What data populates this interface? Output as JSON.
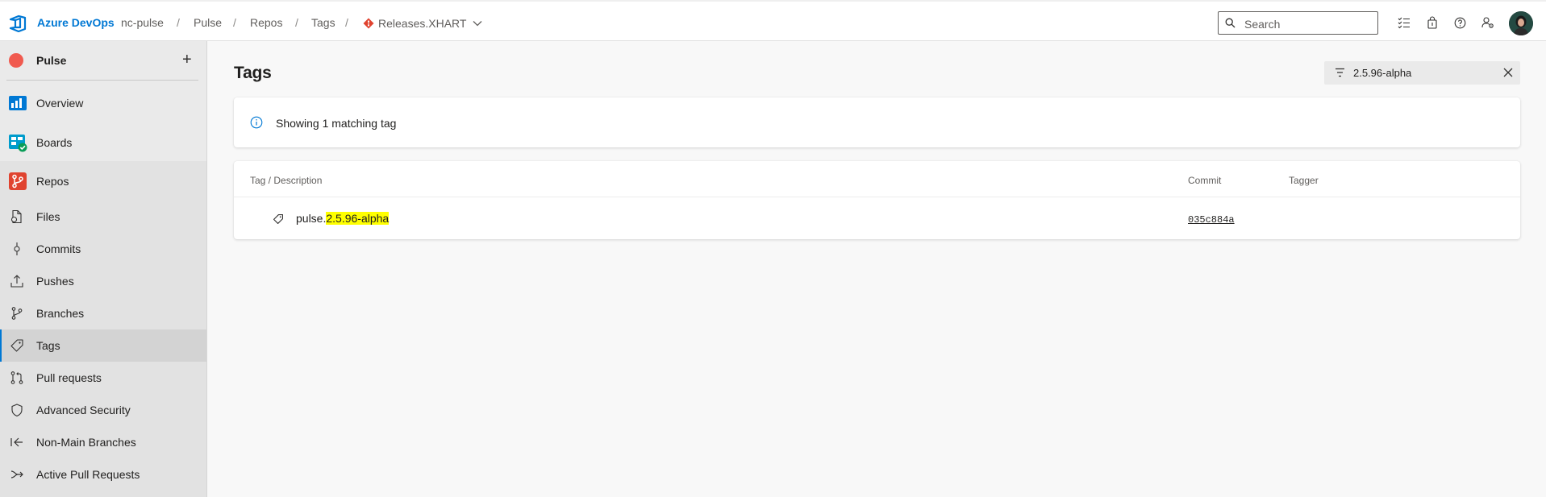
{
  "header": {
    "brand": "Azure DevOps",
    "breadcrumbs": [
      "nc-pulse",
      "Pulse",
      "Repos",
      "Tags"
    ],
    "separator": "/",
    "repo": "Releases.XHART",
    "search_placeholder": "Search",
    "icons": [
      "work-items-icon",
      "marketplace-icon",
      "help-icon",
      "user-settings-icon"
    ]
  },
  "sidebar": {
    "project": "Pulse",
    "add_label": "+",
    "items": [
      {
        "label": "Overview",
        "icon": "overview-icon"
      },
      {
        "label": "Boards",
        "icon": "boards-icon"
      },
      {
        "label": "Repos",
        "icon": "repos-icon"
      },
      {
        "label": "Files",
        "icon": "files-icon"
      },
      {
        "label": "Commits",
        "icon": "commits-icon"
      },
      {
        "label": "Pushes",
        "icon": "pushes-icon"
      },
      {
        "label": "Branches",
        "icon": "branches-icon"
      },
      {
        "label": "Tags",
        "icon": "tag-icon",
        "selected": true
      },
      {
        "label": "Pull requests",
        "icon": "pull-request-icon"
      },
      {
        "label": "Advanced Security",
        "icon": "shield-icon"
      },
      {
        "label": "Non-Main Branches",
        "icon": "branch-out-icon"
      },
      {
        "label": "Active Pull Requests",
        "icon": "arrow-merge-icon"
      }
    ]
  },
  "main": {
    "title": "Tags",
    "filter_value": "2.5.96-alpha",
    "info_text": "Showing 1 matching tag",
    "columns": [
      "Tag / Description",
      "Commit",
      "Tagger"
    ],
    "rows": [
      {
        "tag_prefix": "pulse.",
        "tag_match": "2.5.96-alpha",
        "commit": "035c884a",
        "tagger": ""
      }
    ]
  },
  "colors": {
    "accent": "#0078d4",
    "highlight": "#ffff00",
    "project_icon": "#f05a4f",
    "repos_icon": "#e0432f"
  }
}
